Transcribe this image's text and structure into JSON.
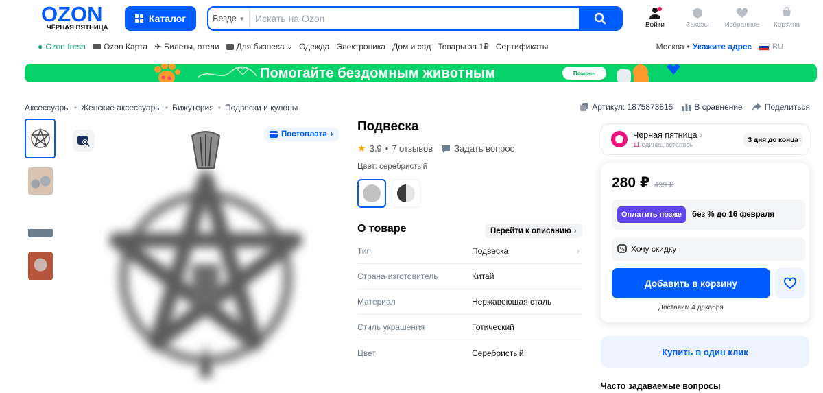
{
  "header": {
    "logo_text": "OZON",
    "logo_subtitle": "ЧЁРНАЯ ПЯТНИЦА",
    "catalog_label": "Каталог",
    "search_scope": "Везде",
    "search_placeholder": "Искать на Ozon",
    "actions": [
      {
        "label": "Войти",
        "icon": "user-icon"
      },
      {
        "label": "Заказы",
        "icon": "box-icon"
      },
      {
        "label": "Избранное",
        "icon": "heart-icon"
      },
      {
        "label": "Корзина",
        "icon": "cart-icon"
      }
    ]
  },
  "nav": {
    "items": [
      "Ozon fresh",
      "Ozon Карта",
      "Билеты, отели",
      "Для бизнеса",
      "Одежда",
      "Электроника",
      "Дом и сад",
      "Товары за 1₽",
      "Сертификаты"
    ],
    "city": "Москва",
    "address_link": "Укажите адрес",
    "lang": "RU"
  },
  "banner": {
    "text": "Помогайте бездомным животным",
    "button": "Помочь"
  },
  "breadcrumbs": [
    "Аксессуары",
    "Женские аксессуары",
    "Бижутерия",
    "Подвески и кулоны"
  ],
  "meta": {
    "article": "Артикул: 1875873815",
    "compare": "В сравнение",
    "share": "Поделиться"
  },
  "gallery": {
    "postpay_label": "Постоплата"
  },
  "product": {
    "title": "Подвеска",
    "rating": "3.9",
    "reviews": "7 отзывов",
    "ask": "Задать вопрос",
    "color_label": "Цвет: серебристый"
  },
  "about": {
    "title": "О товаре",
    "link": "Перейти к описанию",
    "specs": [
      {
        "key": "Тип",
        "value": "Подвеска"
      },
      {
        "key": "Страна-изготовитель",
        "value": "Китай"
      },
      {
        "key": "Материал",
        "value": "Нержавеющая сталь"
      },
      {
        "key": "Стиль украшения",
        "value": "Готический"
      },
      {
        "key": "Цвет",
        "value": "Серебристый"
      }
    ]
  },
  "promo": {
    "name": "Чёрная пятница",
    "units_count": "11",
    "units_text": "единиц осталось",
    "days_left": "3 дня до конца"
  },
  "buy": {
    "price": "280 ₽",
    "old_price": "499 ₽",
    "pay_later_btn": "Оплатить позже",
    "pay_later_text": "без % до 16 февраля",
    "discount": "Хочу скидку",
    "add_to_cart": "Добавить в корзину",
    "delivery": "Доставим 4 декабря",
    "one_click": "Купить в один клик"
  },
  "faq_title": "Часто задаваемые вопросы",
  "colors": {
    "brand": "#005bff",
    "banner": "#06d26a",
    "promo": "#f1117e",
    "pay_later": "#6045ea"
  }
}
